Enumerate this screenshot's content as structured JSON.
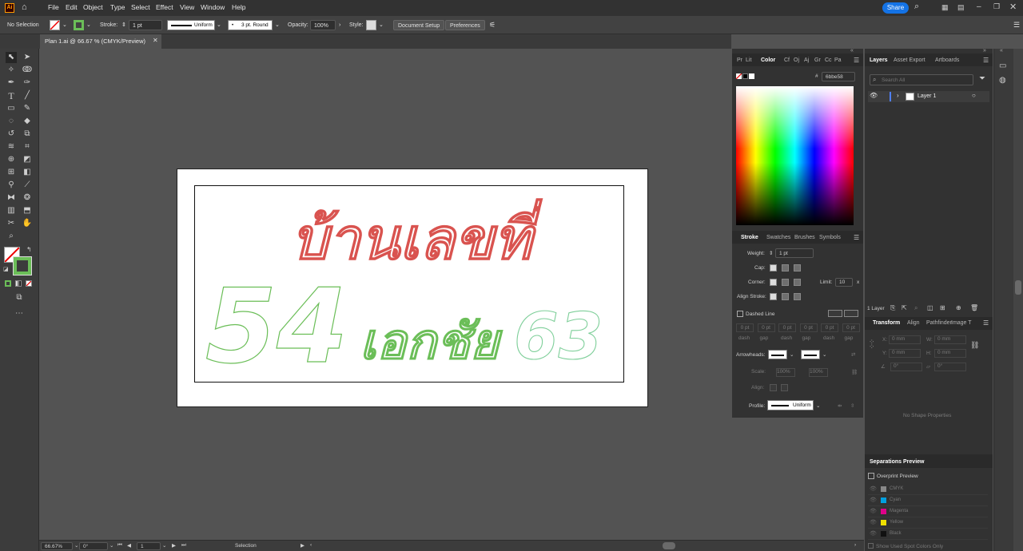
{
  "menubar": {
    "items": [
      "File",
      "Edit",
      "Object",
      "Type",
      "Select",
      "Effect",
      "View",
      "Window",
      "Help"
    ],
    "share_label": "Share"
  },
  "control": {
    "selection": "No Selection",
    "stroke_label": "Stroke:",
    "stroke_value": "1 pt",
    "uniform_label": "Uniform",
    "brush_label": "3 pt. Round",
    "opacity_label": "Opacity:",
    "opacity_value": "100%",
    "style_label": "Style:",
    "doc_setup": "Document Setup",
    "preferences": "Preferences",
    "stroke_color": "#6bbe58"
  },
  "doc": {
    "tab_title": "Plan 1.ai @ 66.67 % (CMYK/Preview)"
  },
  "artwork": {
    "title_text": "บ้านเลขที่",
    "number_text": "54",
    "name_text": "เอกชัย",
    "suffix_text": "63",
    "title_color": "#d9534f",
    "number_color": "#6bbe58",
    "suffix_color": "#7fcf9a"
  },
  "color_panel": {
    "tabs": [
      "Pr",
      "Lit",
      "Color",
      "Cf",
      "Oj",
      "Aj",
      "Gr",
      "Cc",
      "Pa"
    ],
    "hex_label": "#",
    "hex_value": "6bbe58"
  },
  "stroke_panel": {
    "tabs": [
      "Stroke",
      "Swatches",
      "Brushes",
      "Symbols"
    ],
    "weight_label": "Weight:",
    "weight_value": "1 pt",
    "cap_label": "Cap:",
    "corner_label": "Corner:",
    "limit_label": "Limit:",
    "limit_value": "10",
    "limit_x": "x",
    "align_label": "Align Stroke:",
    "dashed_label": "Dashed Line",
    "dash_cells": [
      "dash",
      "gap",
      "dash",
      "gap",
      "dash",
      "gap"
    ],
    "dash_pt": "0 pt",
    "arrowheads_label": "Arrowheads:",
    "scale_label": "Scale:",
    "scale_value": "100%",
    "align2_label": "Align:",
    "profile_label": "Profile:",
    "profile_value": "Uniform"
  },
  "layers_panel": {
    "tabs": [
      "Layers",
      "Asset Export",
      "Artboards"
    ],
    "search_placeholder": "Search All",
    "layer_name": "Layer 1",
    "count": "1 Layer"
  },
  "transform_panel": {
    "tabs": [
      "Transform",
      "Align",
      "Pathfinder",
      "Image T"
    ],
    "x_label": "X:",
    "y_label": "Y:",
    "w_label": "W:",
    "h_label": "H:",
    "x_value": "0 mm",
    "y_value": "0 mm",
    "w_value": "0 mm",
    "h_value": "0 mm",
    "angle_value": "0°",
    "empty": "No Shape Properties"
  },
  "separations": {
    "title": "Separations Preview",
    "overprint": "Overprint Preview",
    "inks": [
      {
        "name": "CMYK",
        "color": "#888888"
      },
      {
        "name": "Cyan",
        "color": "#00a0e0"
      },
      {
        "name": "Magenta",
        "color": "#e0008a"
      },
      {
        "name": "Yellow",
        "color": "#f0e000"
      },
      {
        "name": "Black",
        "color": "#111111"
      }
    ],
    "spot_only": "Show Used Spot Colors Only"
  },
  "status": {
    "zoom": "66.67%",
    "rotation": "0°",
    "artboard_num": "1",
    "tool_name": "Selection"
  }
}
